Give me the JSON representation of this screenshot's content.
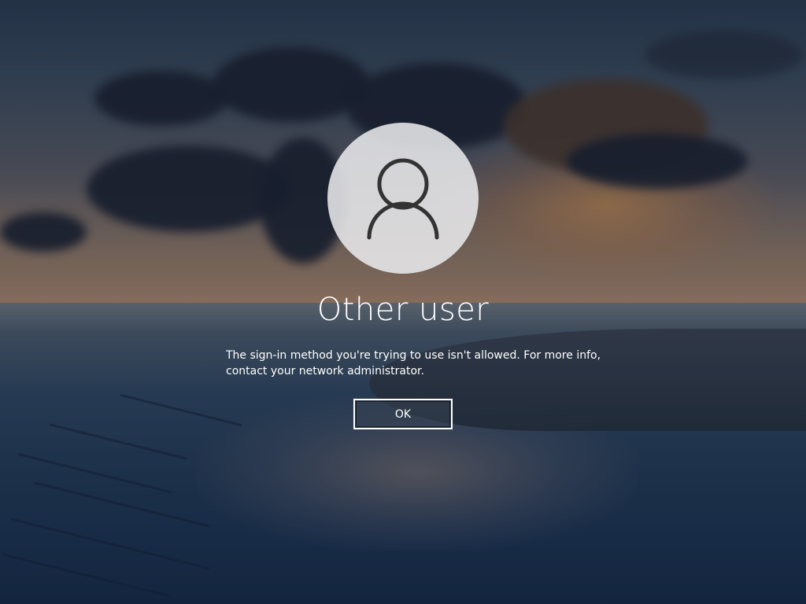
{
  "login": {
    "user_name": "Other user",
    "message_line1": "The sign-in method you're trying to use isn't allowed. For more info,",
    "message_line2": "contact your network administrator.",
    "ok_label": "OK",
    "avatar_icon": "user-icon"
  },
  "colors": {
    "text": "#ffffff",
    "avatar_bg": "#e8e8ea",
    "avatar_glyph": "#333333"
  }
}
